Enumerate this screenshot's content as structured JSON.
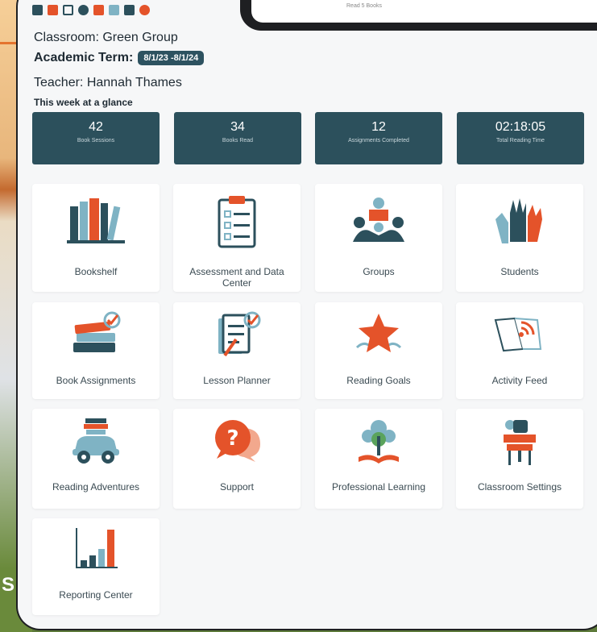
{
  "colors": {
    "teal": "#2c505c",
    "orange": "#e4532a",
    "light_teal": "#7fb3c4",
    "green": "#5aa35c"
  },
  "header": {
    "classroom": "Classroom: Green Group",
    "term_label": "Academic Term:",
    "term_value": "8/1/23 -8/1/24",
    "teacher": "Teacher: Hannah Thames",
    "week": "This week at a glance"
  },
  "top_caption": "Read 5 Books",
  "background_letter": "S",
  "stats": [
    {
      "value": "42",
      "label": "Book Sessions"
    },
    {
      "value": "34",
      "label": "Books Read"
    },
    {
      "value": "12",
      "label": "Assignments Completed"
    },
    {
      "value": "02:18:05",
      "label": "Total Reading Time"
    }
  ],
  "tiles": {
    "bookshelf": {
      "label": "Bookshelf",
      "icon": "bookshelf-icon"
    },
    "assessment": {
      "label": "Assessment and Data Center",
      "icon": "clipboard-icon"
    },
    "groups": {
      "label": "Groups",
      "icon": "group-reading-icon"
    },
    "students": {
      "label": "Students",
      "icon": "raised-hands-icon"
    },
    "book_assignments": {
      "label": "Book Assignments",
      "icon": "book-stack-check-icon"
    },
    "lesson_planner": {
      "label": "Lesson Planner",
      "icon": "planner-check-icon"
    },
    "reading_goals": {
      "label": "Reading Goals",
      "icon": "star-icon"
    },
    "activity_feed": {
      "label": "Activity Feed",
      "icon": "book-broadcast-icon"
    },
    "reading_adventures": {
      "label": "Reading Adventures",
      "icon": "car-books-icon"
    },
    "support": {
      "label": "Support",
      "icon": "question-bubble-icon"
    },
    "professional_learning": {
      "label": "Professional Learning",
      "icon": "tree-book-icon"
    },
    "classroom_settings": {
      "label": "Classroom Settings",
      "icon": "desk-chair-icon"
    },
    "reporting_center": {
      "label": "Reporting Center",
      "icon": "bar-chart-icon"
    }
  }
}
